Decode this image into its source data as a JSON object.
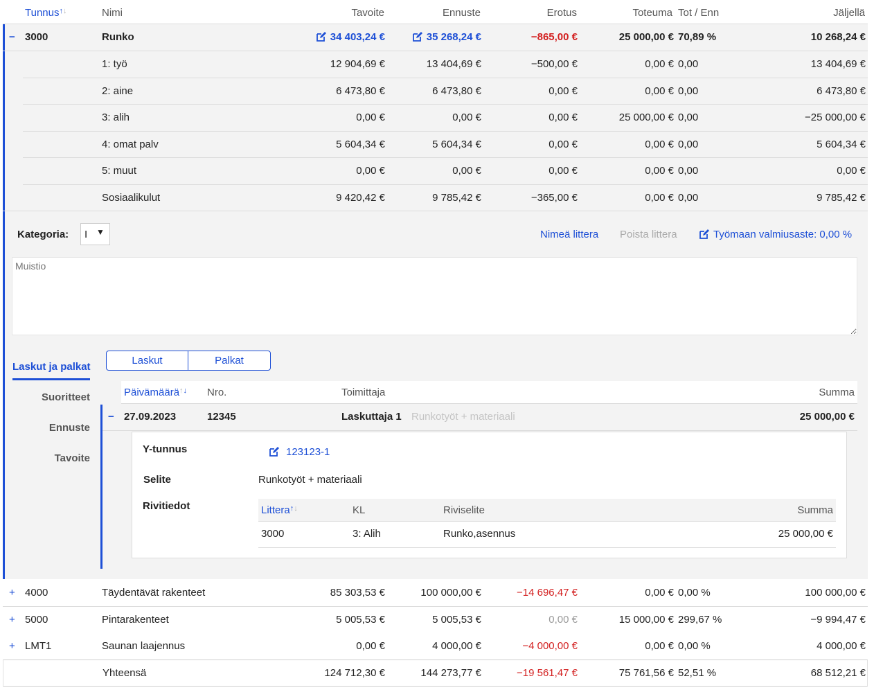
{
  "header": {
    "tunnus": "Tunnus",
    "nimi": "Nimi",
    "tavoite": "Tavoite",
    "ennuste": "Ennuste",
    "erotus": "Erotus",
    "toteuma": "Toteuma",
    "tot_enn": "Tot / Enn",
    "jaljella": "Jäljellä"
  },
  "expanded": {
    "toggle": "−",
    "tunnus": "3000",
    "nimi": "Runko",
    "tavoite": "34 403,24 €",
    "ennuste": "35 268,24 €",
    "erotus": "−865,00 €",
    "toteuma": "25 000,00 €",
    "tot_enn": "70,89 %",
    "jaljella": "10 268,24 €"
  },
  "sub_rows": [
    {
      "nimi": "1: työ",
      "tavoite": "12 904,69 €",
      "ennuste": "13 404,69 €",
      "erotus": "−500,00 €",
      "toteuma": "0,00 €",
      "tot_enn": "0,00",
      "jaljella": "13 404,69 €"
    },
    {
      "nimi": "2: aine",
      "tavoite": "6 473,80 €",
      "ennuste": "6 473,80 €",
      "erotus": "0,00 €",
      "toteuma": "0,00 €",
      "tot_enn": "0,00",
      "jaljella": "6 473,80 €"
    },
    {
      "nimi": "3: alih",
      "tavoite": "0,00 €",
      "ennuste": "0,00 €",
      "erotus": "0,00 €",
      "toteuma": "25 000,00 €",
      "tot_enn": "0,00",
      "jaljella": "−25 000,00 €"
    },
    {
      "nimi": "4: omat palv",
      "tavoite": "5 604,34 €",
      "ennuste": "5 604,34 €",
      "erotus": "0,00 €",
      "toteuma": "0,00 €",
      "tot_enn": "0,00",
      "jaljella": "5 604,34 €"
    },
    {
      "nimi": "5: muut",
      "tavoite": "0,00 €",
      "ennuste": "0,00 €",
      "erotus": "0,00 €",
      "toteuma": "0,00 €",
      "tot_enn": "0,00",
      "jaljella": "0,00 €"
    },
    {
      "nimi": "Sosiaalikulut",
      "tavoite": "9 420,42 €",
      "ennuste": "9 785,42 €",
      "erotus": "−365,00 €",
      "toteuma": "0,00 €",
      "tot_enn": "0,00",
      "jaljella": "9 785,42 €"
    }
  ],
  "detail": {
    "kategoria_label": "Kategoria:",
    "kategoria_value": "I",
    "rename_link": "Nimeä littera",
    "delete_link": "Poista littera",
    "progress_link": "Työmaan valmiusaste: 0,00 %",
    "memo_placeholder": "Muistio"
  },
  "side_tabs": [
    "Laskut ja palkat",
    "Suoritteet",
    "Ennuste",
    "Tavoite"
  ],
  "toggle_buttons": [
    "Laskut",
    "Palkat"
  ],
  "invoice_header": {
    "date": "Päivämäärä",
    "nro": "Nro.",
    "supplier": "Toimittaja",
    "sum": "Summa"
  },
  "invoice": {
    "toggle": "−",
    "date": "27.09.2023",
    "nro": "12345",
    "supplier": "Laskuttaja 1",
    "desc_hint": "Runkotyöt + materiaali",
    "sum": "25 000,00 €",
    "ytunnus_label": "Y-tunnus",
    "ytunnus_value": "123123-1",
    "selite_label": "Selite",
    "selite_value": "Runkotyöt + materiaali",
    "rivitiedot_label": "Rivitiedot"
  },
  "line_header": {
    "littera": "Littera",
    "kl": "KL",
    "riviselite": "Riviselite",
    "summa": "Summa"
  },
  "line_rows": [
    {
      "littera": "3000",
      "kl": "3: Alih",
      "riviselite": "Runko,asennus",
      "summa": "25 000,00 €"
    }
  ],
  "other_rows": [
    {
      "toggle": "+",
      "tunnus": "4000",
      "nimi": "Täydentävät rakenteet",
      "tavoite": "85 303,53 €",
      "ennuste": "100 000,00 €",
      "erotus": "−14 696,47 €",
      "toteuma": "0,00 €",
      "tot_enn": "0,00 %",
      "jaljella": "100 000,00 €"
    },
    {
      "toggle": "+",
      "tunnus": "5000",
      "nimi": "Pintarakenteet",
      "tavoite": "5 005,53 €",
      "ennuste": "5 005,53 €",
      "erotus": "0,00 €",
      "toteuma": "15 000,00 €",
      "tot_enn": "299,67 %",
      "jaljella": "−9 994,47 €"
    },
    {
      "toggle": "+",
      "tunnus": "LMT1",
      "nimi": "Saunan laajennus",
      "tavoite": "0,00 €",
      "ennuste": "4 000,00 €",
      "erotus": "−4 000,00 €",
      "toteuma": "0,00 €",
      "tot_enn": "0,00 %",
      "jaljella": "4 000,00 €"
    }
  ],
  "totals": {
    "nimi": "Yhteensä",
    "tavoite": "124 712,30 €",
    "ennuste": "144 273,77 €",
    "erotus": "−19 561,47 €",
    "toteuma": "75 761,56 €",
    "tot_enn": "52,51 %",
    "jaljella": "68 512,21 €"
  },
  "colors": {
    "accent": "#1d4fd6",
    "negative": "#d32020",
    "muted": "#9a9a9a"
  }
}
